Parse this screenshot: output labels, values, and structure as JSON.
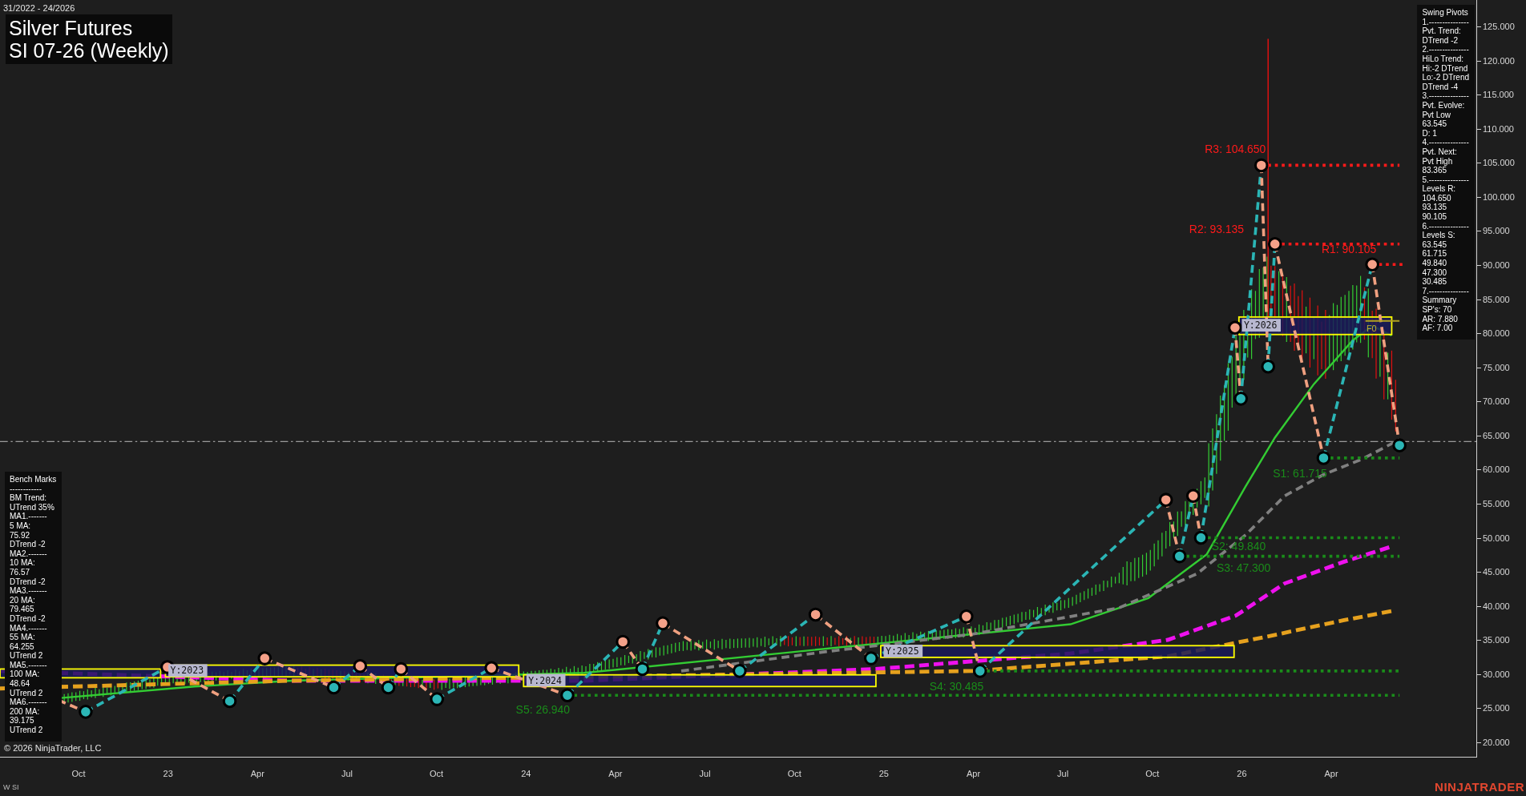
{
  "header": {
    "date_range": "31/2022 - 24/2026",
    "title": "Silver Futures",
    "subtitle": "SI 07-26 (Weekly)"
  },
  "swing_pivots": [
    "Swing Pivots",
    "1.---------------",
    "Pvt. Trend:",
    "DTrend -2",
    "2.---------------",
    "HiLo Trend:",
    "Hi:-2 DTrend",
    "Lo:-2 DTrend",
    "DTrend -4",
    "3.---------------",
    "Pvt. Evolve:",
    "Pvt Low",
    "63.545",
    "D: 1",
    "4.---------------",
    "Pvt. Next:",
    "Pvt High",
    "83.365",
    "5.---------------",
    "Levels R:",
    "104.650",
    "93.135",
    "90.105",
    "6.---------------",
    "Levels S:",
    "63.545",
    "61.715",
    "49.840",
    "47.300",
    "30.485",
    "7.---------------",
    "Summary",
    "SP's: 70",
    "AR: 7.880",
    "AF: 7.00"
  ],
  "bench_marks": [
    "Bench Marks",
    "------------",
    "BM Trend:",
    "UTrend 35%",
    "MA1.-------",
    "5 MA:",
    "75.92",
    "DTrend -2",
    "MA2.-------",
    "10 MA:",
    "76.57",
    "DTrend -2",
    "MA3.-------",
    "20 MA:",
    "79.465",
    "DTrend -2",
    "MA4.-------",
    "55 MA:",
    "64.255",
    "UTrend 2",
    "MA5.-------",
    "100 MA:",
    "48.64",
    "UTrend 2",
    "MA6.-------",
    "200 MA:",
    "39.175",
    "UTrend 2"
  ],
  "level_labels": [
    {
      "text": "R3: 104.650",
      "kind": "resistance"
    },
    {
      "text": "R2: 93.135",
      "kind": "resistance"
    },
    {
      "text": "R1: 90.105",
      "kind": "resistance"
    },
    {
      "text": "S1: 61.715",
      "kind": "support"
    },
    {
      "text": "S2: 49.840",
      "kind": "support"
    },
    {
      "text": "S3: 47.300",
      "kind": "support"
    },
    {
      "text": "S4: 30.485",
      "kind": "support"
    },
    {
      "text": "S5: 26.940",
      "kind": "support"
    }
  ],
  "year_labels": [
    "Y:2023",
    "Y:2024",
    "Y:2025",
    "Y:2026"
  ],
  "fib_label": "F0",
  "y_axis": [
    "125.000",
    "120.000",
    "115.000",
    "110.000",
    "105.000",
    "100.000",
    "95.000",
    "90.000",
    "85.000",
    "80.000",
    "75.000",
    "70.000",
    "65.000",
    "60.000",
    "55.000",
    "50.000",
    "45.000",
    "40.000",
    "35.000",
    "30.000",
    "25.000",
    "20.000"
  ],
  "x_axis": [
    "Oct",
    "23",
    "Apr",
    "Jul",
    "Oct",
    "24",
    "Apr",
    "Jul",
    "Oct",
    "25",
    "Apr",
    "Jul",
    "Oct",
    "26",
    "Apr"
  ],
  "copyright": "© 2026 NinjaTrader, LLC",
  "instrument": "W SI",
  "brand": "NINJATRADER"
}
